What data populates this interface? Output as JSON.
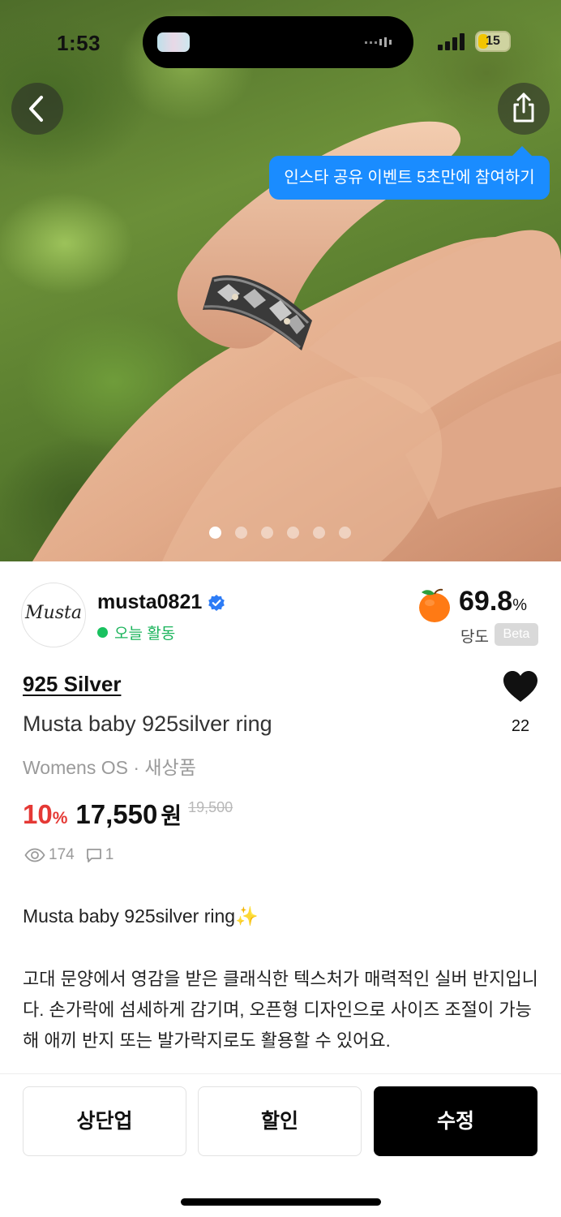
{
  "status_bar": {
    "time": "1:53",
    "battery": "15"
  },
  "header": {
    "tooltip": "인스타 공유 이벤트 5초만에 참여하기",
    "image_pages": 6,
    "active_page": 1
  },
  "seller": {
    "avatar_text": "Musta",
    "name": "musta0821",
    "verified": true,
    "activity": "오늘 활동",
    "score": "69.8",
    "score_unit": "%",
    "score_label": "당도",
    "beta_badge": "Beta"
  },
  "product": {
    "brand": "925 Silver",
    "name": "Musta baby 925silver ring",
    "meta": "Womens OS · 새상품",
    "likes": "22",
    "discount": "10",
    "discount_unit": "%",
    "price": "17,550",
    "price_unit": "원",
    "original_price": "19,500",
    "views": "174",
    "comments": "1"
  },
  "description": {
    "title": "Musta baby 925silver ring✨",
    "body": "고대 문양에서 영감을 받은 클래식한 텍스처가 매력적인 실버 반지입니다. 손가락에 섬세하게 감기며, 오픈형 디자인으로 사이즈 조절이 가능해 애끼 반지 또는 발가락지로도 활용할 수 있어요."
  },
  "actions": {
    "bump_label": "상단업",
    "discount_label": "할인",
    "edit_label": "수정"
  },
  "colors": {
    "accent_blue": "#1a8cff",
    "discount_red": "#e53935",
    "active_green": "#19b35a",
    "primary_button": "#000000"
  }
}
